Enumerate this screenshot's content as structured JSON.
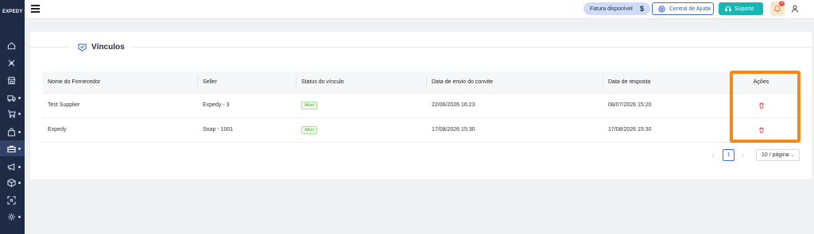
{
  "brand": {
    "logo_text": "EXPEDY"
  },
  "sidebar": {
    "items": [
      {
        "icon": "home-icon"
      },
      {
        "icon": "tools-icon"
      },
      {
        "icon": "store-icon"
      },
      {
        "icon": "truck-icon"
      },
      {
        "icon": "cart-icon"
      },
      {
        "icon": "bag-icon"
      },
      {
        "icon": "briefcase-icon"
      },
      {
        "icon": "megaphone-icon"
      },
      {
        "icon": "box-icon"
      },
      {
        "icon": "scan-icon"
      },
      {
        "icon": "settings-icon"
      }
    ]
  },
  "topbar": {
    "invoice_label": "Fatura disponível",
    "invoice_currency": "$",
    "help_label": "Central de Ajuda",
    "support_label": "Suporte",
    "notification_count": "3"
  },
  "page": {
    "title": "Vínculos"
  },
  "table": {
    "columns": [
      "Nome do Fornecedor",
      "Seller",
      "Status do vínculo",
      "Data de envio do convite",
      "Data de resposta",
      "Ações"
    ],
    "rows": [
      {
        "supplier": "Test Supplier",
        "seller": "Expedy - 3",
        "status": "Ativo",
        "invite_date": "22/06/2026 16:23",
        "response_date": "08/07/2026 15:20"
      },
      {
        "supplier": "Expedy",
        "seller": "Snap - 1001",
        "status": "Ativo",
        "invite_date": "17/08/2026 15:30",
        "response_date": "17/08/2026 15:30"
      }
    ]
  },
  "pagination": {
    "prev": "‹",
    "current_page": "1",
    "next": "›",
    "page_size": "10 / página"
  },
  "colors": {
    "sidebar_bg": "#1f2a44",
    "highlight": "#f28a1b",
    "support_bg": "#18b6b0",
    "status_green": "#4aa526",
    "delete_red": "#e5484d"
  }
}
